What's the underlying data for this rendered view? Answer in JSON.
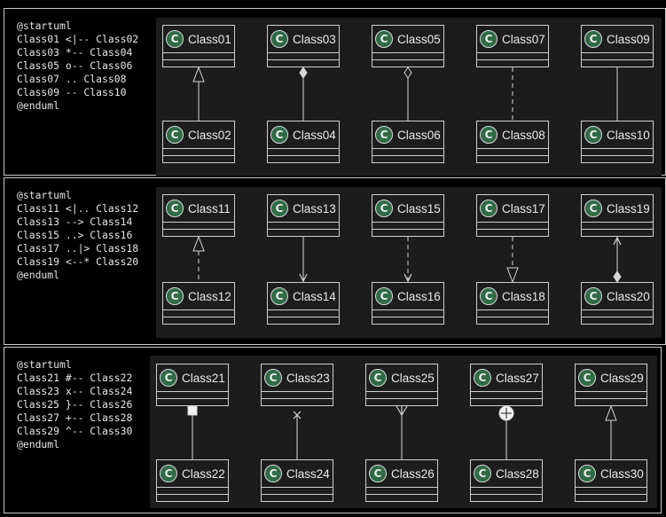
{
  "colors": {
    "background": "#000000",
    "canvas": "#1c1c1c",
    "class_fill": "#1d1d1d",
    "border": "#cfcfcf",
    "badge": "#2f6b45",
    "text": "#e9e9e9",
    "edge": "#d6d6d6"
  },
  "icons": {
    "class_badge": "circle-c-icon"
  },
  "sections": [
    {
      "code": [
        "@startuml",
        "Class01 <|-- Class02",
        "Class03 *-- Class04",
        "Class05 o-- Class06",
        "Class07 .. Class08",
        "Class09 -- Class10",
        "@enduml"
      ],
      "relations": [
        {
          "from": "Class01",
          "to": "Class02",
          "kind": "extension",
          "line": "solid",
          "end_marker": "hollow-triangle"
        },
        {
          "from": "Class03",
          "to": "Class04",
          "kind": "composition",
          "line": "solid",
          "end_marker": "filled-diamond"
        },
        {
          "from": "Class05",
          "to": "Class06",
          "kind": "aggregation",
          "line": "solid",
          "end_marker": "hollow-diamond"
        },
        {
          "from": "Class07",
          "to": "Class08",
          "kind": "dotted",
          "line": "dashed",
          "end_marker": "none"
        },
        {
          "from": "Class09",
          "to": "Class10",
          "kind": "association",
          "line": "solid",
          "end_marker": "none"
        }
      ]
    },
    {
      "code": [
        "@startuml",
        "Class11 <|.. Class12",
        "Class13 --> Class14",
        "Class15 ..> Class16",
        "Class17 ..|> Class18",
        "Class19 <--* Class20",
        "@enduml"
      ],
      "relations": [
        {
          "from": "Class11",
          "to": "Class12",
          "kind": "realization",
          "line": "dashed",
          "end_marker": "hollow-triangle"
        },
        {
          "from": "Class13",
          "to": "Class14",
          "kind": "directed-association",
          "line": "solid",
          "end_marker": "open-arrow"
        },
        {
          "from": "Class15",
          "to": "Class16",
          "kind": "dependency",
          "line": "dashed",
          "end_marker": "open-arrow"
        },
        {
          "from": "Class17",
          "to": "Class18",
          "kind": "realization",
          "line": "dashed",
          "end_marker": "hollow-triangle"
        },
        {
          "from": "Class19",
          "to": "Class20",
          "kind": "composition-arrow",
          "line": "solid",
          "end_marker": "open-arrow+filled-diamond"
        }
      ]
    },
    {
      "code": [
        "@startuml",
        "Class21 #-- Class22",
        "Class23 x-- Class24",
        "Class25 }-- Class26",
        "Class27 +-- Class28",
        "Class29 ^-- Class30",
        "@enduml"
      ],
      "relations": [
        {
          "from": "Class21",
          "to": "Class22",
          "kind": "square",
          "line": "solid",
          "end_marker": "filled-square"
        },
        {
          "from": "Class23",
          "to": "Class24",
          "kind": "cross",
          "line": "solid",
          "end_marker": "x-mark"
        },
        {
          "from": "Class25",
          "to": "Class26",
          "kind": "crowfoot",
          "line": "solid",
          "end_marker": "crowfoot"
        },
        {
          "from": "Class27",
          "to": "Class28",
          "kind": "nested",
          "line": "solid",
          "end_marker": "circle-plus"
        },
        {
          "from": "Class29",
          "to": "Class30",
          "kind": "extension",
          "line": "solid",
          "end_marker": "hollow-triangle"
        }
      ]
    }
  ]
}
